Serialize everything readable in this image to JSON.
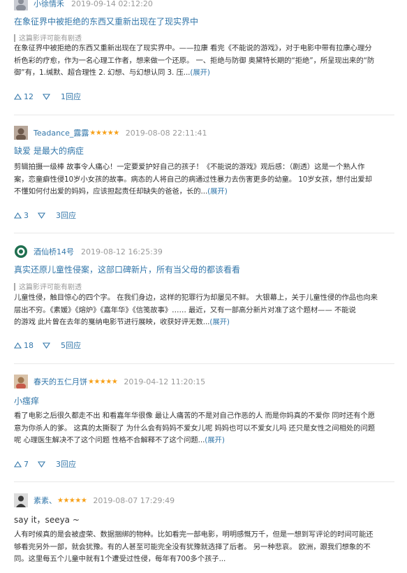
{
  "reviews": [
    {
      "user": "小徐情禾",
      "stars": "",
      "time": "2019-09-14 02:12:20",
      "title": "在象征界中被拒绝的东西又重新出现在了现实界中",
      "spoiler": "这篇影评可能有剧透",
      "lines": [
        "在象征界中被拒绝的东西又重新出现在了现实界中。——拉康 看完《不能说的游戏》，对于电影中带有拉康心理分",
        "析色彩的疗愈，作为一名心理工作者，想来做一个还原。 一、拒绝与防御 奥黛特长期的“拒绝”，所呈现出来的“防",
        "御”有，1.缄默、超合理性 2. 幻想、与幻想认同 3. 压..."
      ],
      "expand": "(展开)",
      "up": "12",
      "replies": "1回应",
      "avatar": "avatar-person-1"
    },
    {
      "user": "Teadance_露露",
      "stars": "★★★★★",
      "time": "2019-08-08 22:11:41",
      "title": "缺爱 是最大的病症",
      "spoiler": "",
      "lines": [
        "剪辑拍摄一级棒 故事令人痛心！一定要爱护好自己的孩子！《不能说的游戏》观后感：（剧透）这是一个熟人作",
        "案，恋童癖性侵10岁小女孩的故事。病态的人将自己的病通过性暴力去伤害更多的幼童。 10岁女孩，想付出爱却",
        "不懂如何付出爱的妈妈，应该担起责任却缺失的爸爸，长的..."
      ],
      "expand": "(展开)",
      "up": "3",
      "replies": "3回应",
      "avatar": "avatar-person-2"
    },
    {
      "user": "酒仙桥14号",
      "stars": "",
      "time": "2019-08-12 16:25:39",
      "title": "真实还原儿童性侵案，这部口碑新片，所有当父母的都该看看",
      "spoiler": "这篇影评可能有剧透",
      "lines": [
        "儿童性侵，触目惊心的四个字。 在我们身边，这样的犯罪行为却屡见不鲜。 大银幕上，关于儿童性侵的作品也向来",
        "层出不穷。《素媛》《熔炉》《嘉年华》《信笺故事》…… 最近，又有一部高分新片对准了这个题材—— 不能说",
        "的游戏 此片曾在去年的戛纳电影节进行展映，收获好评无数..."
      ],
      "expand": "(展开)",
      "up": "18",
      "replies": "5回应",
      "avatar": "avatar-logo-3"
    },
    {
      "user": "春天的五仁月饼",
      "stars": "★★★★★",
      "time": "2019-04-12 11:20:15",
      "title": "小瘙痒",
      "spoiler": "",
      "lines": [
        "看了电影之后很久都走不出 和看嘉年华很像 最让人痛苦的不是对自己作恶的人 而是你妈真的不爱你 同时还有个愿",
        "意为你杀人的爹。 这真的太撕裂了 为什么会有妈妈不爱女儿呢 妈妈也可以不爱女儿吗 还只是女性之间相处的问题",
        "呢 心理医生解决不了这个问题 性格不合解释不了这个问题..."
      ],
      "expand": "(展开)",
      "up": "7",
      "replies": "3回应",
      "avatar": "avatar-person-4"
    },
    {
      "user": "素素、",
      "stars": "★★★★★",
      "time": "2019-08-07 17:29:49",
      "title": "say it，seeya ~",
      "spoiler": "",
      "lines": [
        "人有时候真的是会被虚荣、数据捆绑的物种。比如看完一部电影，明明感慨万千，但是一想到写评论的时间可能还",
        "够看完另外一部，就会犹豫。有的人甚至可能完全没有犹豫就选择了后者。 另一种悲哀。 欧洲，跟我们想象的不",
        "同。这里每五个儿童中就有1个遭受过性侵，每年有700多个孩子..."
      ],
      "expand": "",
      "up": "",
      "replies": "",
      "avatar": "avatar-person-5"
    }
  ]
}
